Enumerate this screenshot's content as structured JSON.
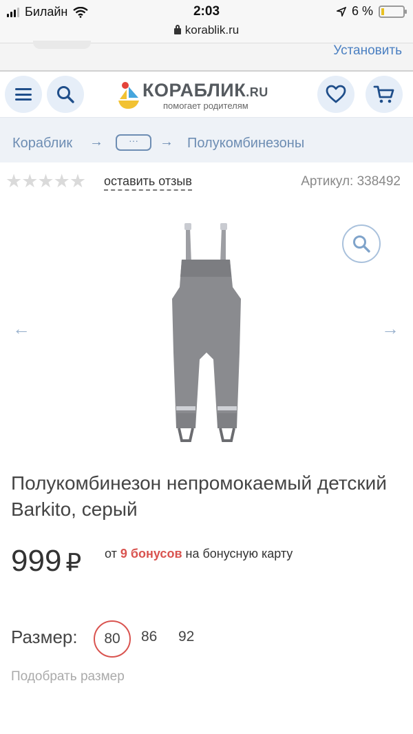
{
  "status_bar": {
    "carrier": "Билайн",
    "time": "2:03",
    "battery_percent": "6 %"
  },
  "browser": {
    "url": "korablik.ru"
  },
  "app_banner": {
    "install_label": "Установить"
  },
  "header": {
    "logo_name": "КОРАБЛИК",
    "logo_suffix": ".RU",
    "logo_tagline": "помогает родителям"
  },
  "breadcrumbs": {
    "root": "Кораблик",
    "ellipsis": "···",
    "current": "Полукомбинезоны",
    "separator": "→"
  },
  "rating": {
    "stars": "★★★★★",
    "filled_stars": 0,
    "review_link": "оставить отзыв"
  },
  "sku": "Артикул: 338492",
  "gallery": {
    "prev_arrow": "←",
    "next_arrow": "→"
  },
  "product": {
    "title": "Полукомбинезон непромокаемый детский Barkito, серый",
    "price": "999",
    "currency": "₽",
    "bonus_prefix": "от ",
    "bonus_amount": "9 бонусов",
    "bonus_suffix": " на бонусную карту"
  },
  "sizes": {
    "label": "Размер:",
    "options": [
      "80",
      "86",
      "92"
    ],
    "selected": "80",
    "pick_link": "Подобрать размер"
  },
  "colors": {
    "accent": "#4a7fc1",
    "crumb": "#6d8db3",
    "selected_size": "#d9534f",
    "bonus": "#d9534f",
    "icon": "#1f4e8a"
  },
  "icons": [
    "menu-icon",
    "search-icon",
    "heart-icon",
    "cart-icon",
    "zoom-icon",
    "lock-icon",
    "wifi-icon",
    "location-icon"
  ]
}
